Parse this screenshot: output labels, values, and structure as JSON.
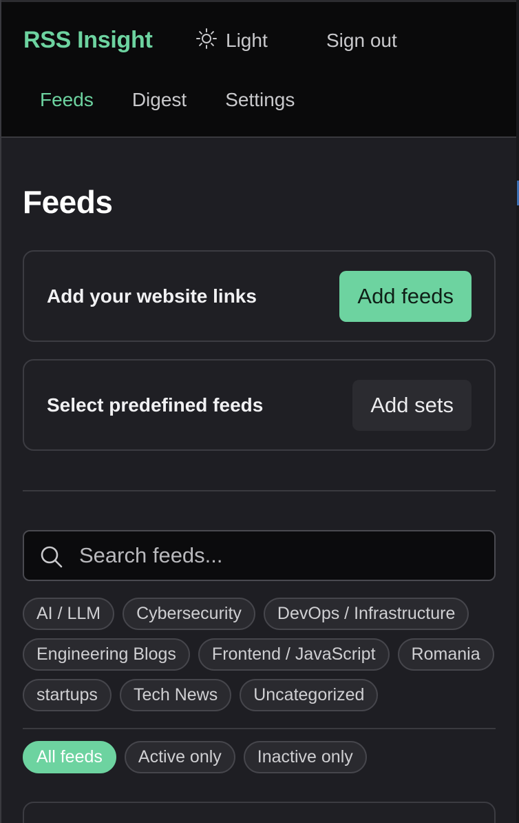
{
  "header": {
    "brand": "RSS Insight",
    "theme_label": "Light",
    "signout_label": "Sign out",
    "nav": [
      {
        "label": "Feeds",
        "active": true
      },
      {
        "label": "Digest",
        "active": false
      },
      {
        "label": "Settings",
        "active": false
      }
    ]
  },
  "main": {
    "title": "Feeds",
    "add_links": {
      "label": "Add your website links",
      "button": "Add feeds"
    },
    "predefined": {
      "label": "Select predefined feeds",
      "button": "Add sets"
    },
    "search": {
      "placeholder": "Search feeds..."
    },
    "categories": [
      "AI / LLM",
      "Cybersecurity",
      "DevOps / Infrastructure",
      "Engineering Blogs",
      "Frontend / JavaScript",
      "Romania",
      "startups",
      "Tech News",
      "Uncategorized"
    ],
    "status_filters": [
      {
        "label": "All feeds",
        "active": true
      },
      {
        "label": "Active only",
        "active": false
      },
      {
        "label": "Inactive only",
        "active": false
      }
    ]
  },
  "colors": {
    "accent": "#6dd3a0",
    "background": "#1e1e23",
    "header_background": "#0a0a0b"
  }
}
